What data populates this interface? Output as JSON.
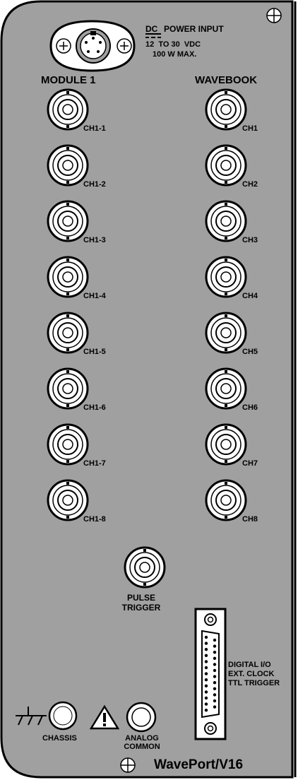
{
  "power": {
    "prefix": "DC",
    "title": "POWER INPUT",
    "range": "12  TO 30  VDC",
    "max": "100 W MAX."
  },
  "module": {
    "header": "MODULE 1",
    "channels": [
      "CH1-1",
      "CH1-2",
      "CH1-3",
      "CH1-4",
      "CH1-5",
      "CH1-6",
      "CH1-7",
      "CH1-8"
    ]
  },
  "wavebook": {
    "header": "WAVEBOOK",
    "channels": [
      "CH1",
      "CH2",
      "CH3",
      "CH4",
      "CH5",
      "CH6",
      "CH7",
      "CH8"
    ]
  },
  "trigger": {
    "line1": "PULSE",
    "line2": "TRIGGER"
  },
  "digital": {
    "line1": "DIGITAL I/O",
    "line2": "EXT. CLOCK",
    "line3": "TTL TRIGGER"
  },
  "chassis": {
    "label": "CHASSIS"
  },
  "analog": {
    "line1": "ANALOG",
    "line2": "COMMON"
  },
  "brand": "WavePort/V16",
  "colors": {
    "panel": "#a0a0a0",
    "outline": "#000000",
    "connector_fill": "#ffffff"
  }
}
